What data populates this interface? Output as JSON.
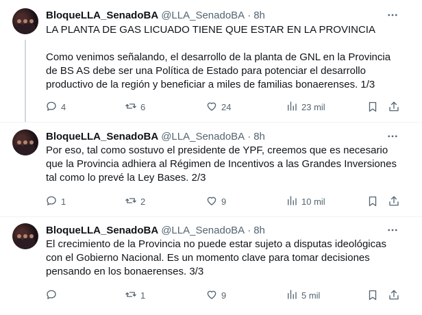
{
  "tweets": [
    {
      "author_name": "BloqueLLA_SenadoBA",
      "handle": "@LLA_SenadoBA",
      "dot": "·",
      "time": "8h",
      "text": "LA PLANTA DE GAS LICUADO TIENE QUE ESTAR EN LA PROVINCIA\n\nComo venimos señalando, el desarrollo de la planta de GNL en la Provincia\nde BS AS debe ser una Política de Estado para potenciar el desarrollo\nproductivo de la región y beneficiar a miles de familias bonaerenses. 1/3",
      "replies": "4",
      "retweets": "6",
      "likes": "24",
      "views": "23 mil"
    },
    {
      "author_name": "BloqueLLA_SenadoBA",
      "handle": "@LLA_SenadoBA",
      "dot": "·",
      "time": "8h",
      "text": "Por eso, tal como sostuvo el presidente de YPF, creemos que es necesario\nque la Provincia adhiera al Régimen de Incentivos a las Grandes Inversiones\ntal como lo prevé la Ley Bases. 2/3",
      "replies": "1",
      "retweets": "2",
      "likes": "9",
      "views": "10 mil"
    },
    {
      "author_name": "BloqueLLA_SenadoBA",
      "handle": "@LLA_SenadoBA",
      "dot": "·",
      "time": "8h",
      "text": "El crecimiento de la Provincia no puede estar sujeto a disputas ideológicas\ncon el Gobierno Nacional. Es un momento clave para tomar decisiones\npensando en los bonaerenses. 3/3",
      "replies": "",
      "retweets": "1",
      "likes": "9",
      "views": "5 mil"
    }
  ],
  "icons": {
    "reply": "reply-icon",
    "retweet": "retweet-icon",
    "like": "heart-icon",
    "views": "views-icon",
    "bookmark": "bookmark-icon",
    "share": "share-icon",
    "more": "more-icon"
  },
  "colors": {
    "icon": "#536471",
    "text": "#0f1419",
    "thread_line": "#cfd9de",
    "separator": "#eff3f4"
  }
}
